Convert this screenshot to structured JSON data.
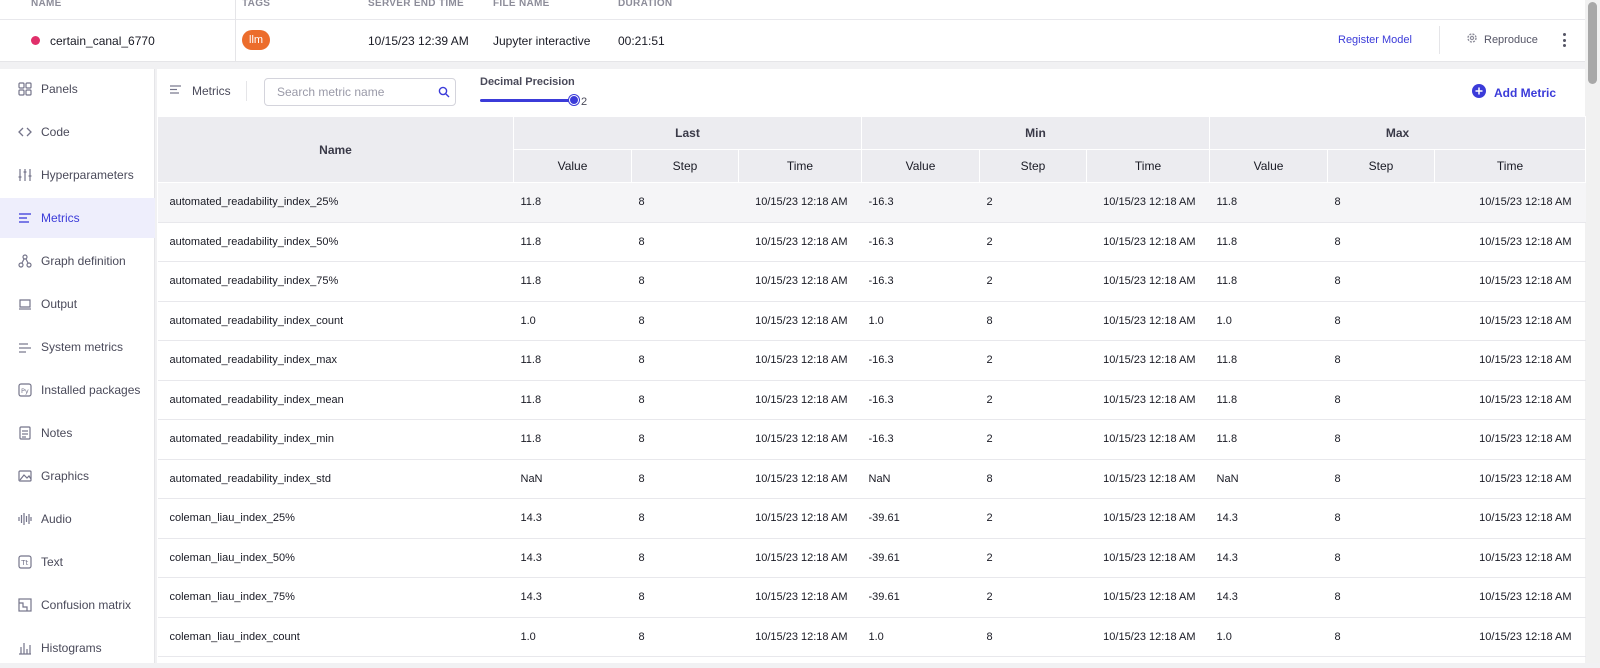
{
  "run": {
    "headers": {
      "name": "NAME",
      "tags": "TAGS",
      "end_time": "SERVER END TIME",
      "file_name": "FILE NAME",
      "duration": "DURATION"
    },
    "name": "certain_canal_6770",
    "tag": "llm",
    "end_time": "10/15/23 12:39 AM",
    "file_name": "Jupyter interactive",
    "duration": "00:21:51",
    "register_label": "Register Model",
    "reproduce_label": "Reproduce",
    "dot_color": "#e02f6a",
    "tag_color": "#ec6d2c"
  },
  "sidebar": {
    "items": [
      {
        "label": "Panels",
        "icon": "panels-icon"
      },
      {
        "label": "Code",
        "icon": "code-icon"
      },
      {
        "label": "Hyperparameters",
        "icon": "sliders-icon"
      },
      {
        "label": "Metrics",
        "icon": "metrics-icon",
        "active": true
      },
      {
        "label": "Graph definition",
        "icon": "graph-icon"
      },
      {
        "label": "Output",
        "icon": "output-icon"
      },
      {
        "label": "System metrics",
        "icon": "system-metrics-icon"
      },
      {
        "label": "Installed packages",
        "icon": "python-icon"
      },
      {
        "label": "Notes",
        "icon": "notes-icon"
      },
      {
        "label": "Graphics",
        "icon": "image-icon"
      },
      {
        "label": "Audio",
        "icon": "audio-icon"
      },
      {
        "label": "Text",
        "icon": "text-icon"
      },
      {
        "label": "Confusion matrix",
        "icon": "confusion-matrix-icon"
      },
      {
        "label": "Histograms",
        "icon": "histogram-icon"
      }
    ]
  },
  "toolbar": {
    "metrics_label": "Metrics",
    "search_placeholder": "Search metric name",
    "precision_label": "Decimal Precision",
    "precision_value": "2",
    "add_metric_label": "Add Metric",
    "accent": "#3b3bd9"
  },
  "table": {
    "name_header": "Name",
    "groups": [
      "Last",
      "Min",
      "Max"
    ],
    "sub_headers": [
      "Value",
      "Step",
      "Time"
    ],
    "rows": [
      [
        "automated_readability_index_25%",
        "11.8",
        "8",
        "10/15/23 12:18 AM",
        "-16.3",
        "2",
        "10/15/23 12:18 AM",
        "11.8",
        "8",
        "10/15/23 12:18 AM"
      ],
      [
        "automated_readability_index_50%",
        "11.8",
        "8",
        "10/15/23 12:18 AM",
        "-16.3",
        "2",
        "10/15/23 12:18 AM",
        "11.8",
        "8",
        "10/15/23 12:18 AM"
      ],
      [
        "automated_readability_index_75%",
        "11.8",
        "8",
        "10/15/23 12:18 AM",
        "-16.3",
        "2",
        "10/15/23 12:18 AM",
        "11.8",
        "8",
        "10/15/23 12:18 AM"
      ],
      [
        "automated_readability_index_count",
        "1.0",
        "8",
        "10/15/23 12:18 AM",
        "1.0",
        "8",
        "10/15/23 12:18 AM",
        "1.0",
        "8",
        "10/15/23 12:18 AM"
      ],
      [
        "automated_readability_index_max",
        "11.8",
        "8",
        "10/15/23 12:18 AM",
        "-16.3",
        "2",
        "10/15/23 12:18 AM",
        "11.8",
        "8",
        "10/15/23 12:18 AM"
      ],
      [
        "automated_readability_index_mean",
        "11.8",
        "8",
        "10/15/23 12:18 AM",
        "-16.3",
        "2",
        "10/15/23 12:18 AM",
        "11.8",
        "8",
        "10/15/23 12:18 AM"
      ],
      [
        "automated_readability_index_min",
        "11.8",
        "8",
        "10/15/23 12:18 AM",
        "-16.3",
        "2",
        "10/15/23 12:18 AM",
        "11.8",
        "8",
        "10/15/23 12:18 AM"
      ],
      [
        "automated_readability_index_std",
        "NaN",
        "8",
        "10/15/23 12:18 AM",
        "NaN",
        "8",
        "10/15/23 12:18 AM",
        "NaN",
        "8",
        "10/15/23 12:18 AM"
      ],
      [
        "coleman_liau_index_25%",
        "14.3",
        "8",
        "10/15/23 12:18 AM",
        "-39.61",
        "2",
        "10/15/23 12:18 AM",
        "14.3",
        "8",
        "10/15/23 12:18 AM"
      ],
      [
        "coleman_liau_index_50%",
        "14.3",
        "8",
        "10/15/23 12:18 AM",
        "-39.61",
        "2",
        "10/15/23 12:18 AM",
        "14.3",
        "8",
        "10/15/23 12:18 AM"
      ],
      [
        "coleman_liau_index_75%",
        "14.3",
        "8",
        "10/15/23 12:18 AM",
        "-39.61",
        "2",
        "10/15/23 12:18 AM",
        "14.3",
        "8",
        "10/15/23 12:18 AM"
      ],
      [
        "coleman_liau_index_count",
        "1.0",
        "8",
        "10/15/23 12:18 AM",
        "1.0",
        "8",
        "10/15/23 12:18 AM",
        "1.0",
        "8",
        "10/15/23 12:18 AM"
      ]
    ]
  }
}
